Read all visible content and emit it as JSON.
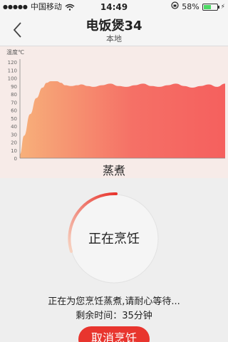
{
  "status_bar": {
    "carrier": "中国移动",
    "time": "14:49",
    "battery_percent": "58%",
    "battery_level": 0.58,
    "signal_dots": "●●●●●",
    "icons": [
      "wifi-icon",
      "rotation-lock-icon",
      "battery-icon",
      "charging-icon"
    ]
  },
  "nav": {
    "title": "电饭煲34",
    "subtitle": "本地",
    "back_icon": "chevron-left-icon"
  },
  "chart_data": {
    "type": "area",
    "ylabel": "温度℃",
    "ylim": [
      0,
      120
    ],
    "yticks": [
      0,
      10,
      20,
      30,
      40,
      50,
      60,
      70,
      80,
      90,
      100,
      110,
      120
    ],
    "x": [
      0,
      2,
      5,
      8,
      11,
      13,
      15,
      18,
      20,
      22,
      25,
      28,
      30,
      33,
      36,
      40,
      44,
      48,
      52,
      56,
      60,
      64,
      68,
      72,
      76,
      80,
      84,
      88,
      92,
      96,
      100
    ],
    "values": [
      5,
      28,
      55,
      75,
      88,
      94,
      96,
      96,
      94,
      91,
      90,
      91,
      92,
      90,
      89,
      91,
      93,
      90,
      89,
      91,
      93,
      90,
      89,
      91,
      93,
      90,
      88,
      90,
      92,
      89,
      93
    ],
    "gradient": [
      "#f7b07a",
      "#f57066",
      "#f5605e"
    ],
    "grid": false
  },
  "mode": "蒸煮",
  "progress": {
    "label": "正在烹饪",
    "arc_start_color": "#f7d6c4",
    "arc_end_color": "#e8352e"
  },
  "message": "正在为您烹饪蒸煮,请耐心等待...",
  "remaining": "剩余时间：35分钟",
  "cancel_label": "取消烹饪",
  "accent_color": "#e8352e"
}
